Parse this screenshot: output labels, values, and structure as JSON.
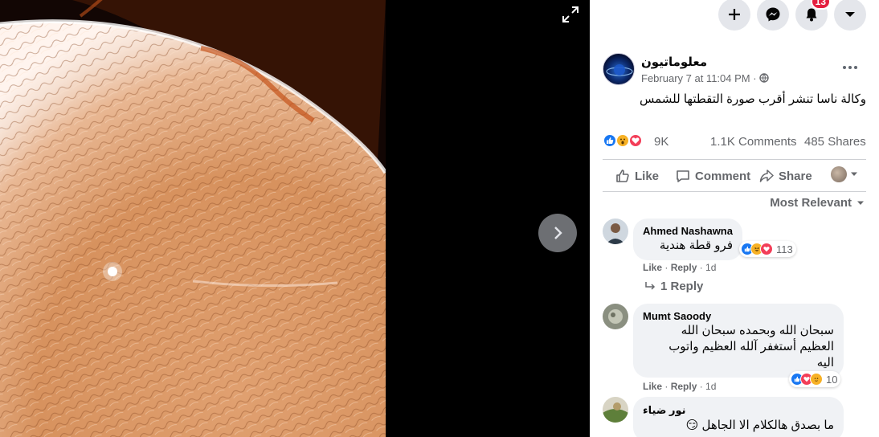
{
  "header": {
    "notification_count": "13"
  },
  "post": {
    "page_name": "معلوماتيون",
    "timestamp": "February 7 at 11:04 PM",
    "separator": "·",
    "text": "وكالة ناسا تنشر أقرب صورة التقطتها للشمس",
    "reaction_count": "9K",
    "comments_count": "1.1K Comments",
    "shares_count": "485 Shares",
    "avatar_text": "معلوماتيون"
  },
  "actions": {
    "like": "Like",
    "comment": "Comment",
    "share": "Share"
  },
  "sort_label": "Most Relevant",
  "comments": [
    {
      "name": "Ahmed Nashawna",
      "text": "فرو قطة هندية",
      "reactions": "113",
      "like": "Like",
      "reply": "Reply",
      "time": "1d"
    },
    {
      "name": "Mumt Saoody",
      "text_lines": [
        "سبحان الله وبحمده سبحان الله",
        "العظيم أستغفر آلله العظيم واتوب",
        "اليه"
      ],
      "reactions": "10",
      "like": "Like",
      "reply": "Reply",
      "time": "1d"
    },
    {
      "name": "نور ضياء",
      "text": "ما بصدق هالكلام الا الجاهل 😏"
    }
  ],
  "replies_link": "1 Reply",
  "colors": {
    "like_blue": "#1877f2",
    "love_red": "#f33e58",
    "wow_yellow": "#f7b125",
    "badge_red": "#e41e3f",
    "panel_text": "#050505",
    "muted": "#65676b"
  }
}
